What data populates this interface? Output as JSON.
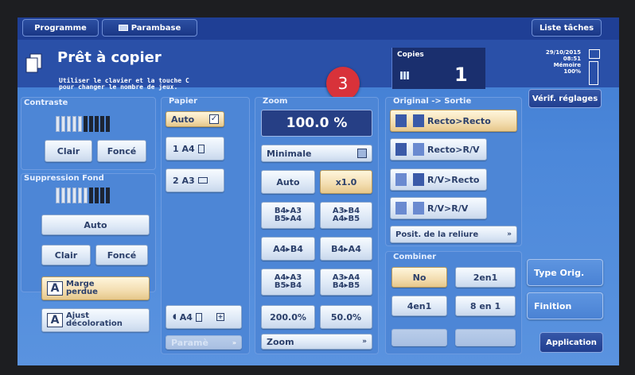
{
  "nav": {
    "programme": "Programme",
    "parambase": "Parambase",
    "liste_taches": "Liste tâches"
  },
  "header": {
    "title": "Prêt à copier",
    "hint_line1": "Utiliser le clavier et la touche C",
    "hint_line2": "pour changer le nombre de jeux.",
    "badge_number": "3",
    "copies_label": "Copies",
    "copies_value": "1",
    "date": "29/10/2015",
    "time": "08:51",
    "memoire_label": "Mémoire",
    "memoire_value": "100%",
    "verif_reglages": "Vérif. réglages"
  },
  "contraste": {
    "label": "Contraste",
    "level_fraction": 0.5,
    "clair": "Clair",
    "fonce": "Foncé"
  },
  "suppression": {
    "label": "Suppression Fond",
    "level_fraction": 0.55,
    "auto": "Auto",
    "clair": "Clair",
    "fonce": "Foncé",
    "marge_line1": "Marge",
    "marge_line2": "perdue",
    "ajust_line1": "Ajust",
    "ajust_line2": "décoloration",
    "icon_letter": "A"
  },
  "papier": {
    "label": "Papier",
    "auto": "Auto",
    "tray1": "1 A4",
    "tray2": "2 A3",
    "bypass": "A4",
    "parametre": "Paramè"
  },
  "zoom": {
    "label": "Zoom",
    "value": "100.0 %",
    "minimale": "Minimale",
    "auto": "Auto",
    "x1": "x1.0",
    "b4a3_1": "B4▸A3",
    "b4a3_2": "B5▸A4",
    "a3b4_1": "A3▸B4",
    "a3b4_2": "A4▸B5",
    "a4b4": "A4▸B4",
    "b4a4": "B4▸A4",
    "a4a3_1": "A4▸A3",
    "a4a3_2": "B5▸B4",
    "a3a4_1": "A3▸A4",
    "a3a4_2": "B4▸B5",
    "p200": "200.0%",
    "p50": "50.0%",
    "zoom_button": "Zoom"
  },
  "original": {
    "label": "Original -> Sortie",
    "recto_recto": "Recto>Recto",
    "recto_rv": "Recto>R/V",
    "rv_recto": "R/V>Recto",
    "rv_rv": "R/V>R/V",
    "posit_reliure": "Posit. de la reliure"
  },
  "combiner": {
    "label": "Combiner",
    "no": "No",
    "en2": "2en1",
    "en4": "4en1",
    "en8": "8 en 1"
  },
  "right": {
    "type_orig": "Type Orig.",
    "finition": "Finition",
    "application": "Application"
  },
  "colors": {
    "accent_badge": "#d8323a",
    "selected": "#f3ddb0",
    "panel": "#4d86d6"
  }
}
